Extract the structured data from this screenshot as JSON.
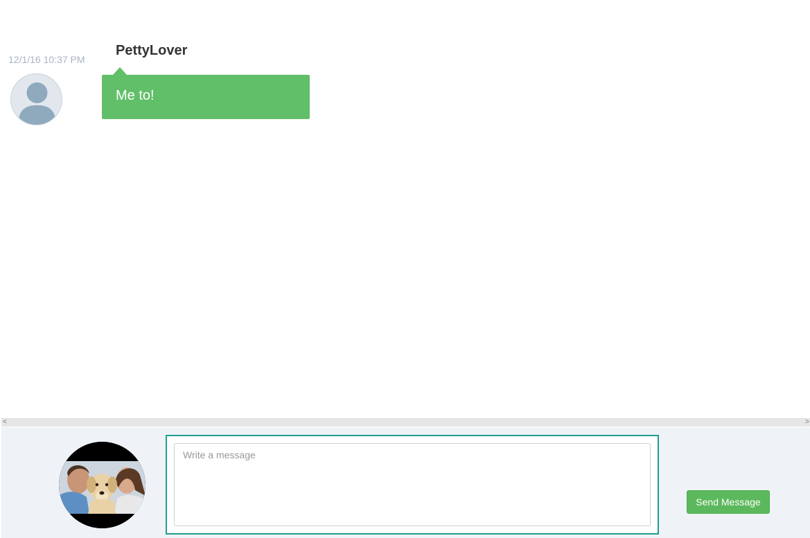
{
  "messages": [
    {
      "timestamp": "12/1/16 10:37 PM",
      "sender": "PettyLover",
      "text": "Me to!",
      "avatar_icon": "default-user-icon"
    }
  ],
  "scrollbar": {
    "left_arrow": "<",
    "right_arrow": ">"
  },
  "composer": {
    "placeholder": "Write a message",
    "value": "",
    "send_label": "Send Message",
    "avatar_icon": "user-profile-photo"
  },
  "colors": {
    "bubble": "#62bf69",
    "send_button": "#5cb85c",
    "input_focus_border": "#1e9c8e",
    "composer_bg": "#eff3f7",
    "timestamp": "#a9b4c2"
  }
}
